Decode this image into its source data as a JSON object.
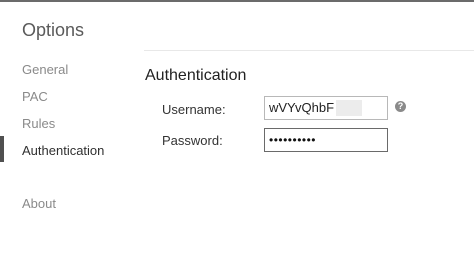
{
  "sidebar": {
    "title": "Options",
    "items": [
      {
        "label": "General"
      },
      {
        "label": "PAC"
      },
      {
        "label": "Rules"
      },
      {
        "label": "Authentication"
      },
      {
        "label": "About"
      }
    ]
  },
  "main": {
    "section_title": "Authentication",
    "username": {
      "label": "Username:",
      "value": "wVYvQhbF"
    },
    "password": {
      "label": "Password:",
      "value": "••••••••••"
    },
    "help_icon": "question-circle-icon"
  },
  "colors": {
    "active_marker": "#505050",
    "nav_inactive": "#8a8a8a",
    "border": "#b8b8b8"
  }
}
